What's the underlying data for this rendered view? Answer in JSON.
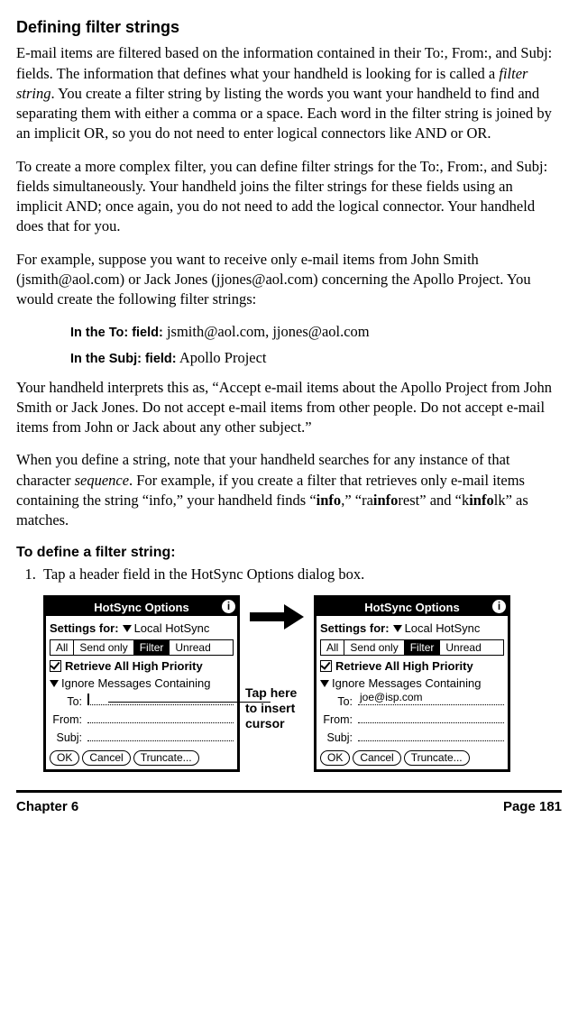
{
  "heading": "Defining filter strings",
  "para1_pre": "E-mail items are filtered based on the information contained in their To:, From:, and Subj: fields. The information that defines what your handheld is looking for is called a ",
  "para1_em": "filter string",
  "para1_post": ". You create a filter string by listing the words you want your handheld to find and separating them with either a comma or a space. Each word in the filter string is joined by an implicit OR, so you do not need to enter logical connectors like AND or OR.",
  "para2": "To create a more complex filter, you can define filter strings for the To:, From:, and Subj: fields simultaneously. Your handheld joins the filter strings for these fields using an implicit AND; once again, you do not need to add the logical connector. Your handheld does that for you.",
  "para3": "For example, suppose you want to receive only e-mail items from John Smith (jsmith@aol.com) or Jack Jones (jjones@aol.com) concerning the Apollo Project. You would create the following filter strings:",
  "to_label": "In the To: field:",
  "to_value": " jsmith@aol.com, jjones@aol.com",
  "subj_label": "In the Subj: field:",
  "subj_value": " Apollo Project",
  "para4": "Your handheld interprets this as, “Accept e-mail items about the Apollo Project from John Smith or Jack Jones. Do not accept e-mail items from other people. Do not accept e-mail items from John or Jack about any other subject.”",
  "para5": {
    "a": "When you define a string, note that your handheld searches for any instance of that character ",
    "em": "sequence",
    "b": ". For example, if you create a filter that retrieves only e-mail items containing the string “info,” your handheld finds “",
    "s1": "info",
    "c": ",” “ra",
    "s2": "info",
    "d": "rest” and “k",
    "s3": "info",
    "e": "lk” as matches."
  },
  "subhead": "To define a filter string:",
  "step1": "Tap a header field in the HotSync Options dialog box.",
  "callout": "Tap here to insert cursor",
  "device": {
    "title": "HotSync Options",
    "settings_label": "Settings for:",
    "settings_value": "Local HotSync",
    "tabs": [
      "All",
      "Send only",
      "Filter",
      "Unread"
    ],
    "chk_label": "Retrieve All High Priority",
    "dd_label": "Ignore Messages Containing",
    "fields": {
      "to": "To:",
      "from": "From:",
      "subj": "Subj:"
    },
    "to_value_screen2": "joe@isp.com",
    "buttons": {
      "ok": "OK",
      "cancel": "Cancel",
      "trunc": "Truncate..."
    }
  },
  "footer": {
    "left": "Chapter 6",
    "right": "Page 181"
  }
}
